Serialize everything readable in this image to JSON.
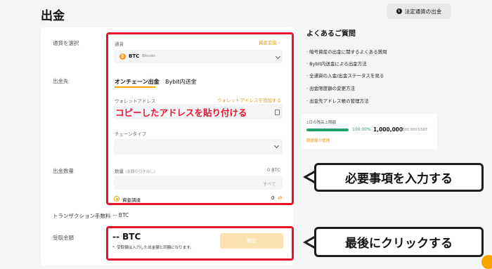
{
  "page": {
    "title": "出金",
    "fiat_button": "法定通貨の出金"
  },
  "form": {
    "select_currency_label": "通貨を選択",
    "destination_label": "出金先",
    "amount_label": "出金数量",
    "fee_label": "トランザクション手数料",
    "fee_value": "-- BTC",
    "receive_label": "受取金額",
    "currency_field_label": "通貨",
    "asset_convert": "資産変換",
    "selected_coin": "BTC",
    "selected_coin_name": "Bitcoin",
    "tabs": [
      "オンチェーン出金",
      "Bybit内送金"
    ],
    "wallet_address_label": "ウォレットアドレス",
    "add_wallet_address": "ウォレットアドレスを追加する",
    "paste_annotation": "コピーしたアドレスを貼り付ける",
    "chain_type_label": "チェーンタイプ",
    "quantity_label": "数量",
    "quantity_hint": "(金額の引き出し)",
    "quantity_balance": "0 BTC",
    "all_button": "すべて",
    "funding_label": "資金調達",
    "funding_value": "0",
    "receive_amount": "-- BTC",
    "receive_note": "*. 受取額は入力した出金額と同額になります。",
    "confirm_button": "確定"
  },
  "faq": {
    "title": "よくあるご質問",
    "items": [
      "暗号資産の出金に関するよくある質問",
      "Bybit内送金による出金方法",
      "全通貨の入金/出金ステータスを見る",
      "出金限度額の変更方法",
      "出金先アドレス帳の管理方法"
    ]
  },
  "limit": {
    "label": "1日の残高上限額",
    "percent": "100.00%",
    "remaining": "1,000,000",
    "total": "/1,000,000 USDT",
    "link": "限度額の管理",
    "fill_fraction": 1.0
  },
  "annotations": {
    "callout_input": "必要事項を入力する",
    "callout_click": "最後にクリックする"
  },
  "colors": {
    "accent": "#f7a600",
    "annotation_red": "#e8142c",
    "success": "#22a06b"
  }
}
